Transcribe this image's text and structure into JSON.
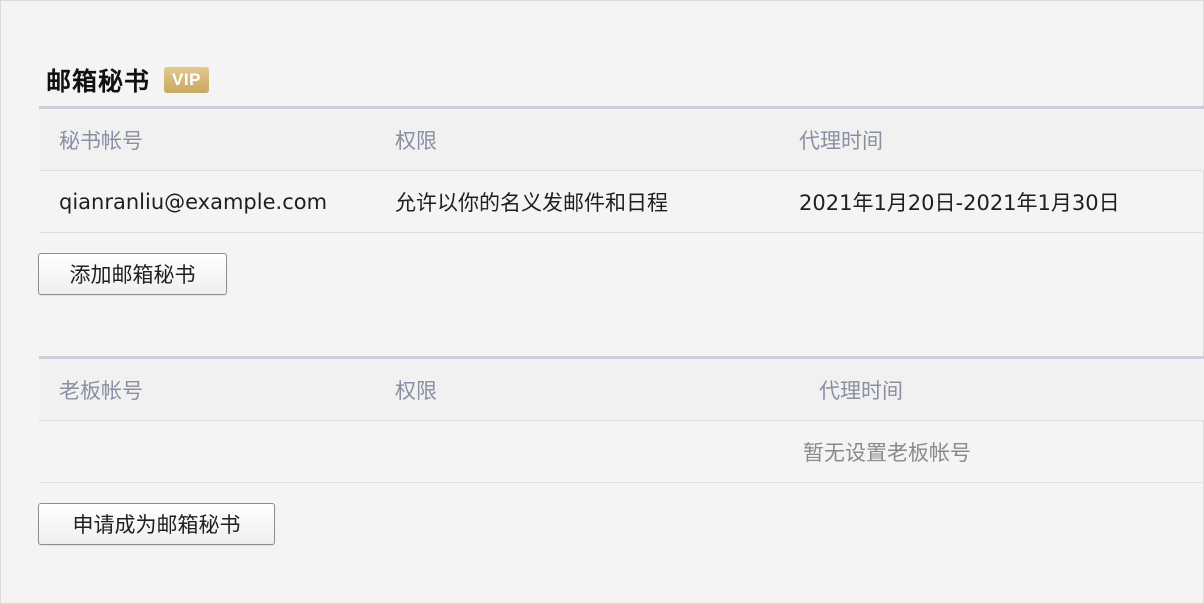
{
  "section": {
    "title": "邮箱秘书",
    "badge": "VIP"
  },
  "secretary_table": {
    "columns": [
      "秘书帐号",
      "权限",
      "代理时间"
    ],
    "rows": [
      {
        "account": "qianranliu@example.com",
        "permission": "允许以你的名义发邮件和日程",
        "period": "2021年1月20日-2021年1月30日"
      }
    ],
    "add_button": "添加邮箱秘书"
  },
  "boss_table": {
    "columns": [
      "老板帐号",
      "权限",
      "代理时间"
    ],
    "empty_text": "暂无设置老板帐号",
    "apply_button": "申请成为邮箱秘书"
  },
  "colors": {
    "header_text": "#8a8fa3",
    "header_rule": "#c9cfdd",
    "vip_gold": "#c9a862"
  }
}
